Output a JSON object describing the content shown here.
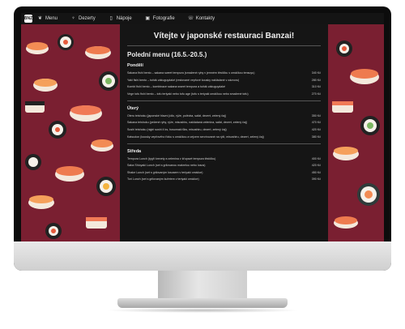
{
  "nav": {
    "logo": "BNZ",
    "items": [
      {
        "label": "Menu",
        "icon": "leaf-icon"
      },
      {
        "label": "Dezerty",
        "icon": "ice-cream-icon"
      },
      {
        "label": "Nápoje",
        "icon": "cup-icon"
      },
      {
        "label": "Fotografie",
        "icon": "camera-icon"
      },
      {
        "label": "Kontakty",
        "icon": "phone-icon"
      }
    ]
  },
  "page": {
    "title": "Vítejte v japonské restauraci Banzai!"
  },
  "menu": {
    "heading": "Polední menu (16.5.-20.5.)",
    "days": [
      {
        "name": "Pondělí",
        "items": [
          {
            "text": "Sakana fishi bento – sakana sweet tempura (smažené ryby v jemném těstíčku s omáčkou tensuyu)",
            "price": "340 Kč"
          },
          {
            "text": "Yaki fishi bento – tuňák zákuguydaké (restované vepřové kousky nakládané v zázvoru)",
            "price": "280 Kč"
          },
          {
            "text": "Kombi fishi bento – kombinace sakana sweet tempura a tuňák zákuguydaké",
            "price": "310 Kč"
          },
          {
            "text": "Vege tofu fishi bento – tofu teriyaki nebo tofu age (tofu s teriyaki omáčkou nebo smažené tofu)",
            "price": "270 Kč"
          }
        ]
      },
      {
        "name": "Úterý",
        "items": [
          {
            "text": "Oteru teishoku (japonské hlavní jídlo, rýže, polévka, salát, dezert, zelený čaj)",
            "price": "350 Kč"
          },
          {
            "text": "Sakana teishoku (pečené ryby, rýže, misoshiru, nakládaná zelenina, salát, dezert, zelený čaj)",
            "price": "470 Kč"
          },
          {
            "text": "Sushi teishoku (nigiri sushi 4 ks, hosomaki 6ks, misoshiru, dezert, zelený čaj)",
            "price": "420 Kč"
          },
          {
            "text": "Katsudon (kousky vepřového řízku s omáčkou a vejcem servírované na rýži, misoshiru, dezert, zelený čaj)",
            "price": "380 Kč"
          }
        ]
      },
      {
        "name": "Středa",
        "items": [
          {
            "text": "Tempura Lunch (tygří krevety a zelenina v křupavé tempura těstíčku)",
            "price": "400 Kč"
          },
          {
            "text": "Saba Shioyaki Lunch (set s grilovanou makrelou nebo losos)",
            "price": "420 Kč"
          },
          {
            "text": "Shake Lunch (set s grilovaným lososem v teriyaki omáčce)",
            "price": "450 Kč"
          },
          {
            "text": "Tori Lunch (set s grilovaným kuřetem v teriyaki omáčce)",
            "price": "390 Kč"
          }
        ]
      }
    ]
  },
  "colors": {
    "background": "#7a1f31",
    "panel": "#151515",
    "nav": "#141414"
  }
}
